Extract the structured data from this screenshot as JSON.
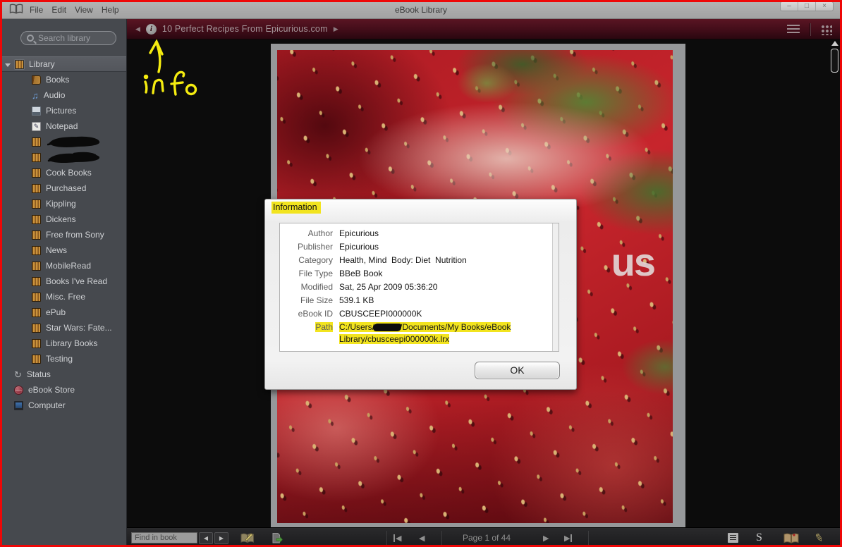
{
  "window": {
    "title": "eBook Library",
    "menus": [
      "File",
      "Edit",
      "View",
      "Help"
    ],
    "controls": {
      "minimize": "–",
      "maximize": "□",
      "close": "×"
    }
  },
  "sidebar": {
    "search_placeholder": "Search library",
    "root_label": "Library",
    "items": [
      {
        "label": "Books",
        "icon": "book-icon"
      },
      {
        "label": "Audio",
        "icon": "music-note-icon"
      },
      {
        "label": "Pictures",
        "icon": "picture-icon"
      },
      {
        "label": "Notepad",
        "icon": "notepad-icon"
      },
      {
        "label": "",
        "icon": "bookshelf-icon",
        "redacted": true
      },
      {
        "label": "",
        "icon": "bookshelf-icon",
        "redacted": true
      },
      {
        "label": "Cook Books",
        "icon": "bookshelf-icon"
      },
      {
        "label": "Purchased",
        "icon": "bookshelf-icon"
      },
      {
        "label": "Kippling",
        "icon": "bookshelf-icon"
      },
      {
        "label": "Dickens",
        "icon": "bookshelf-icon"
      },
      {
        "label": "Free from Sony",
        "icon": "bookshelf-icon"
      },
      {
        "label": "News",
        "icon": "bookshelf-icon"
      },
      {
        "label": "MobileRead",
        "icon": "bookshelf-icon"
      },
      {
        "label": "Books I've Read",
        "icon": "bookshelf-icon"
      },
      {
        "label": "Misc. Free",
        "icon": "bookshelf-icon"
      },
      {
        "label": "ePub",
        "icon": "bookshelf-icon"
      },
      {
        "label": "Star Wars: Fate...",
        "icon": "bookshelf-icon"
      },
      {
        "label": "Library Books",
        "icon": "bookshelf-icon"
      },
      {
        "label": "Testing",
        "icon": "bookshelf-icon"
      }
    ],
    "system_items": [
      {
        "label": "Status",
        "icon": "sync-icon"
      },
      {
        "label": "eBook Store",
        "icon": "globe-icon"
      },
      {
        "label": "Computer",
        "icon": "computer-icon"
      }
    ]
  },
  "viewer": {
    "book_title": "10 Perfect Recipes From Epicurious.com",
    "cover_watermark_fragment": "us"
  },
  "dialog": {
    "title": "Information",
    "fields": [
      {
        "label": "Author",
        "value": "Epicurious"
      },
      {
        "label": "Publisher",
        "value": "Epicurious"
      },
      {
        "label": "Category",
        "value": "Health, Mind  Body: Diet  Nutrition"
      },
      {
        "label": "File Type",
        "value": "BBeB Book"
      },
      {
        "label": "Modified",
        "value": "Sat, 25 Apr 2009 05:36:20"
      },
      {
        "label": "File Size",
        "value": "539.1 KB"
      },
      {
        "label": "eBook ID",
        "value": "CBUSCEEPI000000K"
      }
    ],
    "path_label": "Path",
    "path_line1_prefix": "C:/Users/",
    "path_line1_suffix": "/Documents/My Books/eBook",
    "path_line2": "Library/cbusceepi000000k.lrx",
    "ok_label": "OK"
  },
  "toolbar": {
    "find_placeholder": "Find in book",
    "page_indicator": "Page 1 of 44",
    "font_size_label": "S"
  },
  "annotations": {
    "handwritten_label": "info",
    "highlight_color": "#f2e41f",
    "marker_yellow": "#f5ec10",
    "border_red": "#ee0707"
  }
}
